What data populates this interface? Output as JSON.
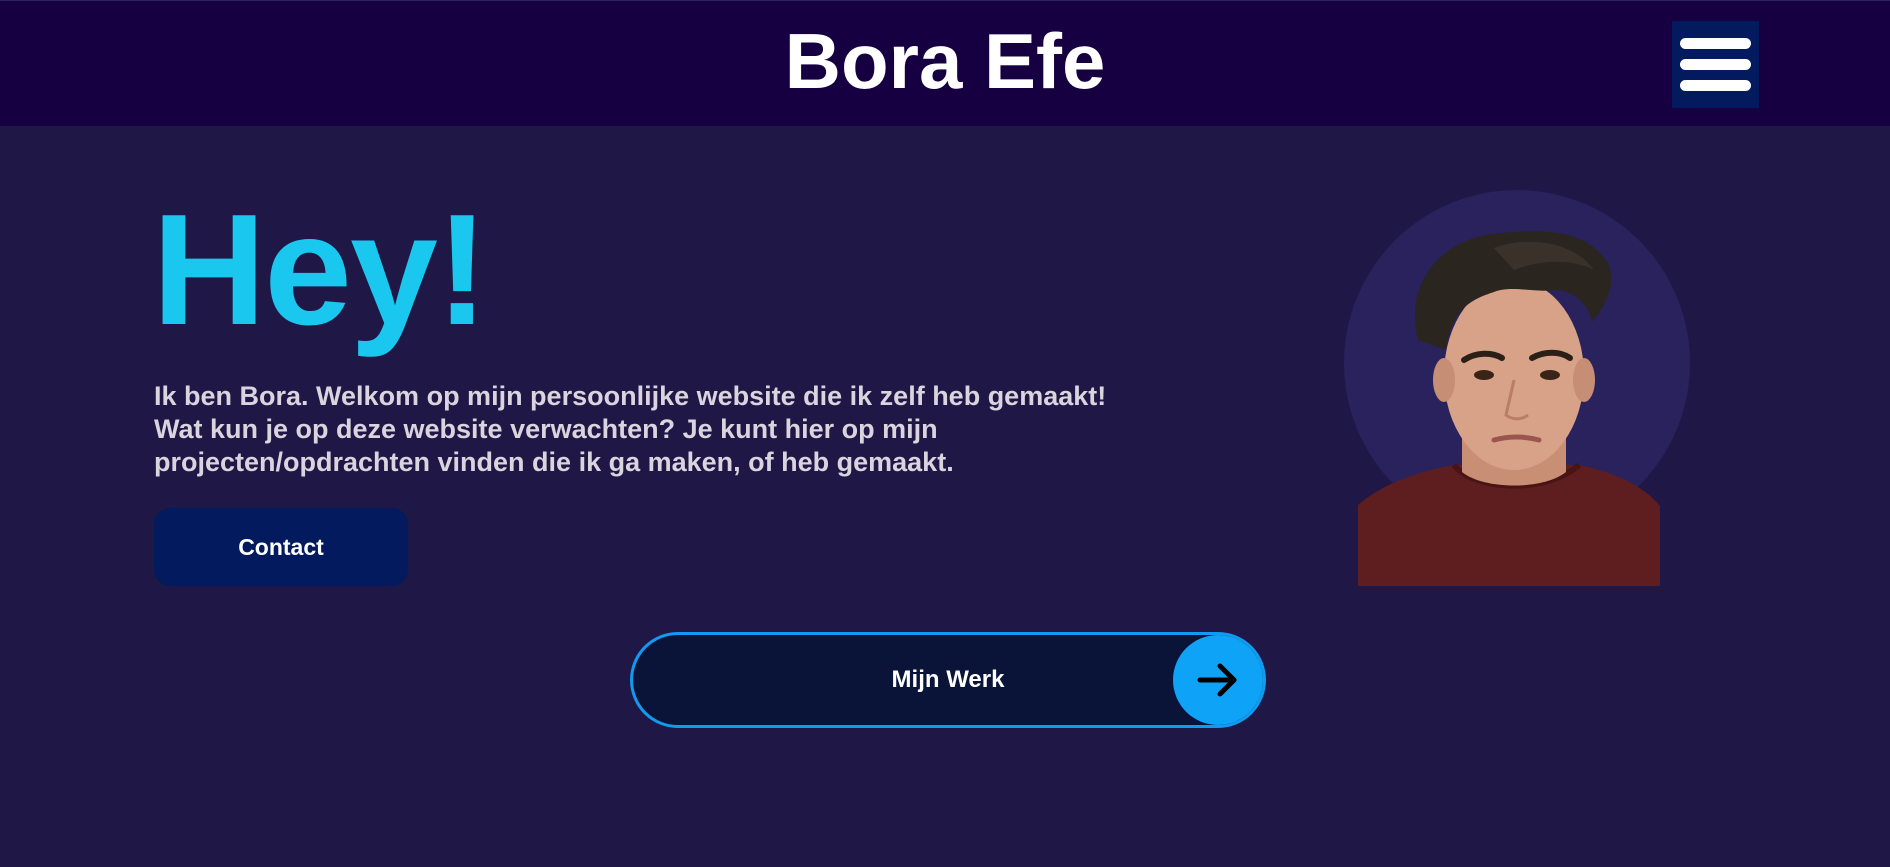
{
  "header": {
    "site_title": "Bora Efe",
    "menu_icon": "hamburger-menu-icon"
  },
  "hero": {
    "heading": "Hey!",
    "intro": "Ik ben Bora. Welkom op mijn persoonlijke website die ik zelf heb gemaakt! Wat kun je op deze website verwachten? Je kunt hier op mijn projecten/opdrachten vinden die ik ga maken, of heb gemaakt.",
    "contact_label": "Contact",
    "portrait_image": "portrait-photo"
  },
  "work": {
    "label": "Mijn Werk",
    "icon": "arrow-right-icon"
  },
  "colors": {
    "header_bg": "#160041",
    "page_bg": "#1f1846",
    "accent_cyan": "#1ac8ef",
    "button_navy": "#031a5e",
    "accent_blue": "#0fa3f7"
  }
}
